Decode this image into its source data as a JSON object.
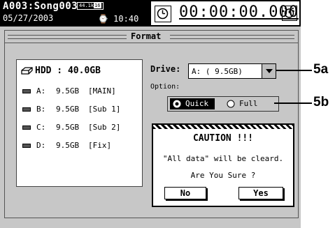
{
  "header": {
    "song": "A003:Song003",
    "date": "05/27/2003",
    "time": "⌚ 10:40",
    "sample_rate": "44.1k",
    "bit_depth": "16",
    "timecode": "00:00:00.000"
  },
  "window": {
    "title": "Format"
  },
  "hdd": {
    "title": "HDD : 40.0GB",
    "partitions": [
      {
        "letter": "A:",
        "size": "9.5GB",
        "name": "[MAIN]"
      },
      {
        "letter": "B:",
        "size": "9.5GB",
        "name": "[Sub 1]"
      },
      {
        "letter": "C:",
        "size": "9.5GB",
        "name": "[Sub 2]"
      },
      {
        "letter": "D:",
        "size": "9.5GB",
        "name": "[Fix]"
      }
    ]
  },
  "drive": {
    "label": "Drive:",
    "value": "A: ( 9.5GB)"
  },
  "option": {
    "label": "Option:",
    "quick": "Quick",
    "full": "Full",
    "selected": "quick"
  },
  "caution": {
    "title": "CAUTION !!!",
    "message1": "\"All data\" will be cleard.",
    "message2": "Are You Sure ?",
    "no_label": "No",
    "yes_label": "Yes"
  },
  "callouts": {
    "a": "5a",
    "b": "5b"
  }
}
